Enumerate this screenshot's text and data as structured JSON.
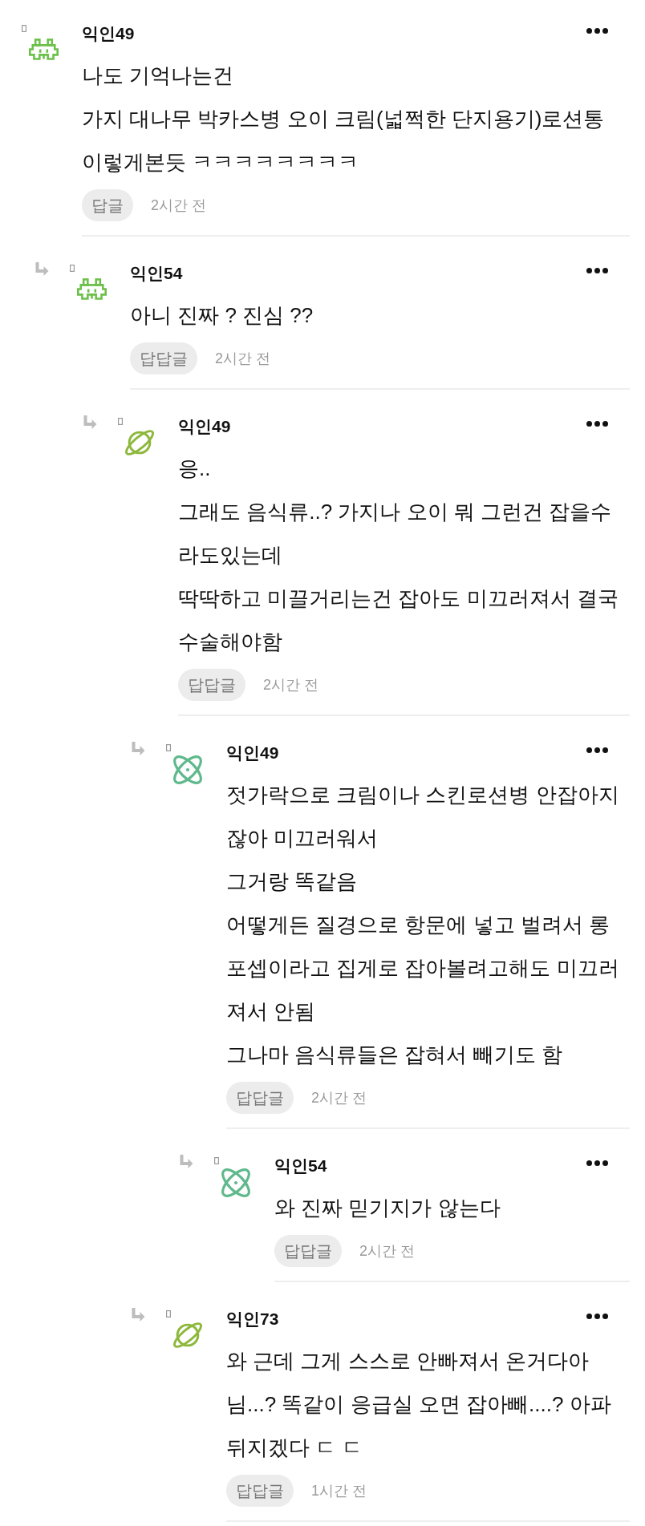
{
  "comments": [
    {
      "author": "익인49",
      "avatar": {
        "kind": "alien",
        "color": "#6cc04a"
      },
      "lines": [
        "나도 기억나는건",
        "가지 대나무 박카스병 오이 크림(넓쩍한 단지용기)로션통",
        "이렇게본듯 ㅋㅋㅋㅋㅋㅋㅋㅋ"
      ],
      "reply_button": "답글",
      "time": "2시간 전",
      "children": [
        {
          "author": "익인54",
          "avatar": {
            "kind": "alien",
            "color": "#6cc04a"
          },
          "lines": [
            "아니 진짜 ? 진심 ??"
          ],
          "reply_button": "답답글",
          "time": "2시간 전",
          "children": [
            {
              "author": "익인49",
              "avatar": {
                "kind": "planet",
                "color": "#8db83c"
              },
              "lines": [
                "응..",
                "그래도 음식류..? 가지나 오이 뭐 그런건 잡을수",
                "라도있는데",
                "딱딱하고 미끌거리는건 잡아도 미끄러져서 결국",
                "수술해야함"
              ],
              "reply_button": "답답글",
              "time": "2시간 전",
              "children": [
                {
                  "author": "익인49",
                  "avatar": {
                    "kind": "atom",
                    "color": "#5fb98c"
                  },
                  "lines": [
                    "젓가락으로 크림이나 스킨로션병 안잡아지",
                    "잖아 미끄러워서",
                    "그거랑 똑같음",
                    "어떻게든 질경으로 항문에 넣고 벌려서 롱",
                    "포셉이라고 집게로 잡아볼려고해도 미끄러",
                    "져서 안됨",
                    "그나마 음식류들은 잡혀서 빼기도 함"
                  ],
                  "reply_button": "답답글",
                  "time": "2시간 전",
                  "children": [
                    {
                      "author": "익인54",
                      "avatar": {
                        "kind": "atom",
                        "color": "#5fb98c"
                      },
                      "lines": [
                        "와 진짜 믿기지가 않는다"
                      ],
                      "reply_button": "답답글",
                      "time": "2시간 전"
                    }
                  ]
                },
                {
                  "author": "익인73",
                  "avatar": {
                    "kind": "planet",
                    "color": "#8db83c"
                  },
                  "lines": [
                    "와 근데 그게 스스로 안빠져서 온거다아",
                    "님...? 똑같이 응급실 오면 잡아빼....? 아파",
                    "뒤지겠다 ㄷ ㄷ"
                  ],
                  "reply_button": "답답글",
                  "time": "1시간 전"
                }
              ]
            }
          ]
        }
      ]
    }
  ]
}
